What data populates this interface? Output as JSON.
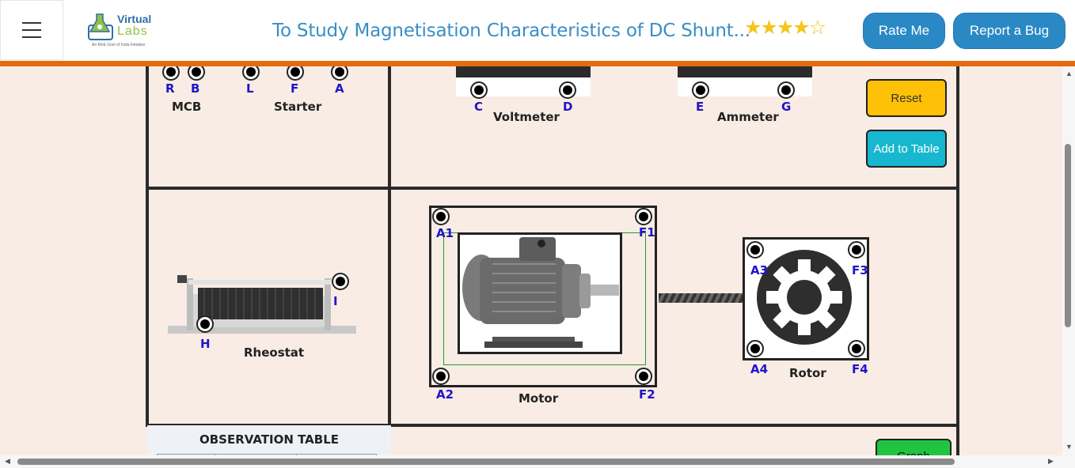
{
  "header": {
    "menu_icon": "hamburger-icon",
    "logo": {
      "line1": "Virtual",
      "line2": "Labs",
      "tagline": "An MoE Govt of India Initiative"
    },
    "title": "To Study Magnetisation Characteristics of DC Shunt...",
    "rating_stars": "★★★★☆",
    "rating_value": 4.5,
    "rate_button": "Rate Me",
    "bug_button": "Report a Bug",
    "accent_color": "#e76a12"
  },
  "top_left_panel": {
    "terminals": [
      "R",
      "B",
      "L",
      "F",
      "A"
    ],
    "mcb_label": "MCB",
    "starter_label": "Starter"
  },
  "meters": {
    "voltmeter": {
      "label": "Voltmeter",
      "terminals": [
        "C",
        "D"
      ]
    },
    "ammeter": {
      "label": "Ammeter",
      "terminals": [
        "E",
        "G"
      ]
    }
  },
  "controls": {
    "reset": "Reset",
    "add_to_table": "Add to Table",
    "graph": "Graph"
  },
  "rheostat": {
    "label": "Rheostat",
    "terminals": [
      "I",
      "H"
    ]
  },
  "motor": {
    "label": "Motor",
    "terminals": [
      "A1",
      "F1",
      "A2",
      "F2"
    ]
  },
  "rotor": {
    "label": "Rotor",
    "terminals": [
      "A3",
      "F3",
      "A4",
      "F4"
    ]
  },
  "observation": {
    "title": "OBSERVATION TABLE"
  }
}
